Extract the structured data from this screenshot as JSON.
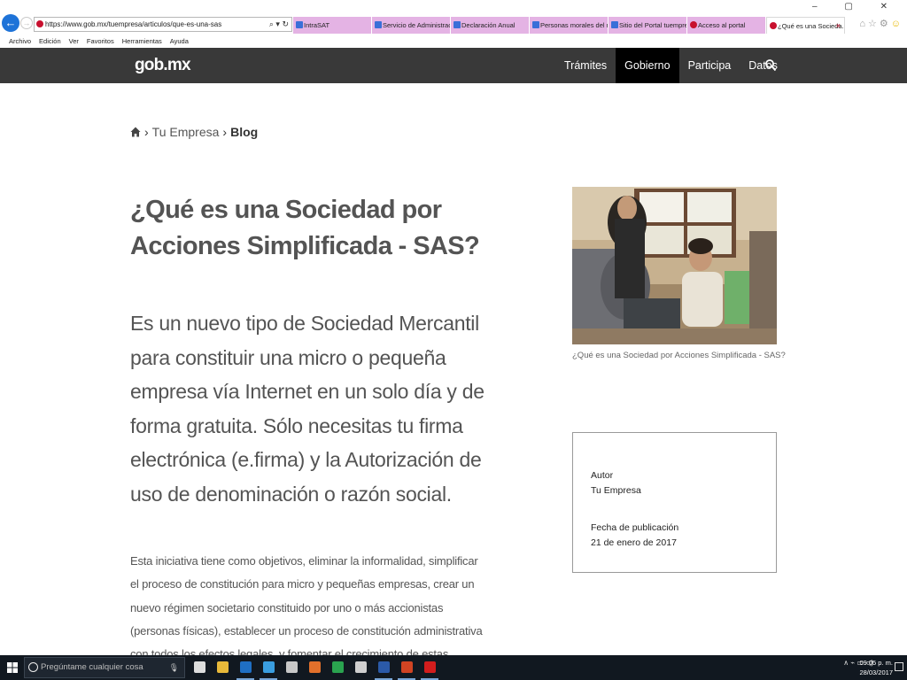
{
  "browser": {
    "url": "https://www.gob.mx/tuempresa/articulos/que-es-una-sas",
    "tabs": [
      {
        "label": "IntraSAT",
        "icon": "blue",
        "active": false,
        "width": 89
      },
      {
        "label": "Servicio de Administraci...",
        "icon": "blue",
        "active": false,
        "width": 89
      },
      {
        "label": "Declaración Anual",
        "icon": "blue",
        "active": false,
        "width": 89
      },
      {
        "label": "Personas morales del ré...",
        "icon": "blue",
        "active": false,
        "width": 89
      },
      {
        "label": "Sitio del Portal tuempres...",
        "icon": "blue",
        "active": false,
        "width": 89
      },
      {
        "label": "Acceso al portal",
        "icon": "red",
        "active": false,
        "width": 89
      },
      {
        "label": "¿Qué es una Socieda...",
        "icon": "red",
        "active": true,
        "width": 89
      }
    ],
    "menu": [
      "Archivo",
      "Edición",
      "Ver",
      "Favoritos",
      "Herramientas",
      "Ayuda"
    ]
  },
  "site": {
    "logo": "gob.mx",
    "nav": [
      {
        "label": "Trámites",
        "active": false
      },
      {
        "label": "Gobierno",
        "active": true
      },
      {
        "label": "Participa",
        "active": false
      },
      {
        "label": "Datos",
        "active": false
      }
    ]
  },
  "breadcrumb": {
    "section": "Tu Empresa",
    "current": "Blog"
  },
  "article": {
    "title": "¿Qué es una Sociedad por Acciones Simplificada - SAS?",
    "lead": "Es un nuevo tipo de Sociedad Mercantil para constituir una micro o pequeña empresa vía Internet en un solo día y de forma gratuita. Sólo necesitas tu firma electrónica (e.firma) y la Autorización de uso de denominación o razón social.",
    "body": "Esta iniciativa tiene como objetivos, eliminar la informalidad, simplificar el proceso de constitución para micro y pequeñas empresas, crear un nuevo régimen societario constituido por uno o más accionistas (personas físicas), establecer un proceso de constitución administrativa con todos los efectos legales, y fomentar el crecimiento de estas empresas para que, en lo futuro",
    "image_caption": "¿Qué es una Sociedad por Acciones Simplificada - SAS?"
  },
  "meta": {
    "author_label": "Autor",
    "author": "Tu Empresa",
    "date_label": "Fecha de publicación",
    "date": "21 de enero de 2017"
  },
  "taskbar": {
    "search_placeholder": "Pregúntame cualquier cosa",
    "time": "09:05 p. m.",
    "date": "28/03/2017",
    "apps": [
      {
        "name": "task-view",
        "color": "#dddddd",
        "running": false
      },
      {
        "name": "file-explorer",
        "color": "#e8b93a",
        "running": false
      },
      {
        "name": "outlook",
        "color": "#1f6fc4",
        "running": true
      },
      {
        "name": "internet-explorer",
        "color": "#3a9ee0",
        "running": true
      },
      {
        "name": "snipping-tool",
        "color": "#c8c8c8",
        "running": false
      },
      {
        "name": "firefox",
        "color": "#e2702b",
        "running": false
      },
      {
        "name": "chrome",
        "color": "#2aa34f",
        "running": false
      },
      {
        "name": "calculator",
        "color": "#cfcfcf",
        "running": false
      },
      {
        "name": "word",
        "color": "#2b5aa8",
        "running": true
      },
      {
        "name": "powerpoint",
        "color": "#d04423",
        "running": true
      },
      {
        "name": "acrobat",
        "color": "#d21d1d",
        "running": true
      }
    ]
  }
}
